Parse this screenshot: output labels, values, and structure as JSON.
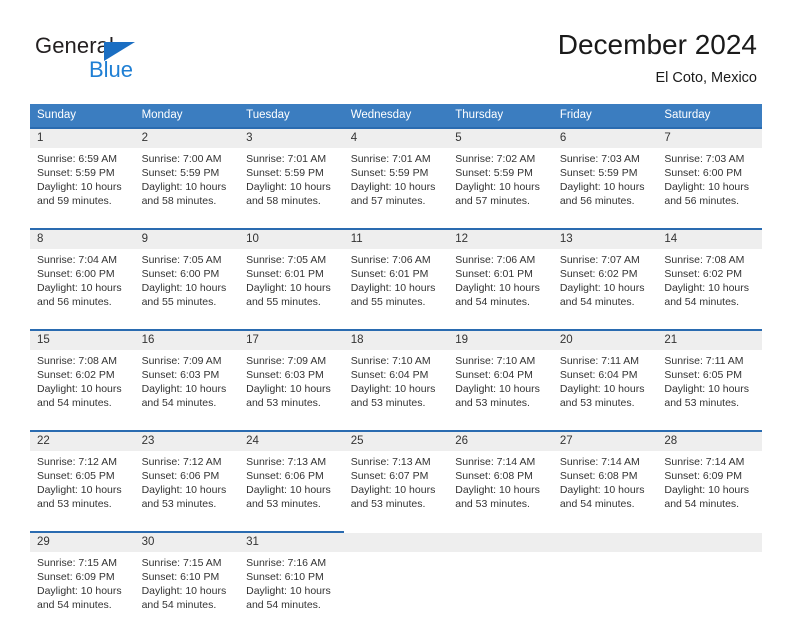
{
  "logo": {
    "word_one": "General",
    "word_two": "Blue",
    "triangle_icon": "blue-triangle-icon",
    "blue": "#1f7fd4",
    "dark": "#231f20"
  },
  "header": {
    "title": "December 2024",
    "subtitle": "El Coto, Mexico"
  },
  "colors": {
    "header_row": "#3b7dc0",
    "week_rule": "#2a6bb0",
    "daynum_band": "#eeeeee",
    "text": "#333333"
  },
  "weekday_headers": [
    "Sunday",
    "Monday",
    "Tuesday",
    "Wednesday",
    "Thursday",
    "Friday",
    "Saturday"
  ],
  "weeks": [
    {
      "days": [
        {
          "num": "1",
          "sunrise": "Sunrise: 6:59 AM",
          "sunset": "Sunset: 5:59 PM",
          "daylight1": "Daylight: 10 hours",
          "daylight2": "and 59 minutes."
        },
        {
          "num": "2",
          "sunrise": "Sunrise: 7:00 AM",
          "sunset": "Sunset: 5:59 PM",
          "daylight1": "Daylight: 10 hours",
          "daylight2": "and 58 minutes."
        },
        {
          "num": "3",
          "sunrise": "Sunrise: 7:01 AM",
          "sunset": "Sunset: 5:59 PM",
          "daylight1": "Daylight: 10 hours",
          "daylight2": "and 58 minutes."
        },
        {
          "num": "4",
          "sunrise": "Sunrise: 7:01 AM",
          "sunset": "Sunset: 5:59 PM",
          "daylight1": "Daylight: 10 hours",
          "daylight2": "and 57 minutes."
        },
        {
          "num": "5",
          "sunrise": "Sunrise: 7:02 AM",
          "sunset": "Sunset: 5:59 PM",
          "daylight1": "Daylight: 10 hours",
          "daylight2": "and 57 minutes."
        },
        {
          "num": "6",
          "sunrise": "Sunrise: 7:03 AM",
          "sunset": "Sunset: 5:59 PM",
          "daylight1": "Daylight: 10 hours",
          "daylight2": "and 56 minutes."
        },
        {
          "num": "7",
          "sunrise": "Sunrise: 7:03 AM",
          "sunset": "Sunset: 6:00 PM",
          "daylight1": "Daylight: 10 hours",
          "daylight2": "and 56 minutes."
        }
      ]
    },
    {
      "days": [
        {
          "num": "8",
          "sunrise": "Sunrise: 7:04 AM",
          "sunset": "Sunset: 6:00 PM",
          "daylight1": "Daylight: 10 hours",
          "daylight2": "and 56 minutes."
        },
        {
          "num": "9",
          "sunrise": "Sunrise: 7:05 AM",
          "sunset": "Sunset: 6:00 PM",
          "daylight1": "Daylight: 10 hours",
          "daylight2": "and 55 minutes."
        },
        {
          "num": "10",
          "sunrise": "Sunrise: 7:05 AM",
          "sunset": "Sunset: 6:01 PM",
          "daylight1": "Daylight: 10 hours",
          "daylight2": "and 55 minutes."
        },
        {
          "num": "11",
          "sunrise": "Sunrise: 7:06 AM",
          "sunset": "Sunset: 6:01 PM",
          "daylight1": "Daylight: 10 hours",
          "daylight2": "and 55 minutes."
        },
        {
          "num": "12",
          "sunrise": "Sunrise: 7:06 AM",
          "sunset": "Sunset: 6:01 PM",
          "daylight1": "Daylight: 10 hours",
          "daylight2": "and 54 minutes."
        },
        {
          "num": "13",
          "sunrise": "Sunrise: 7:07 AM",
          "sunset": "Sunset: 6:02 PM",
          "daylight1": "Daylight: 10 hours",
          "daylight2": "and 54 minutes."
        },
        {
          "num": "14",
          "sunrise": "Sunrise: 7:08 AM",
          "sunset": "Sunset: 6:02 PM",
          "daylight1": "Daylight: 10 hours",
          "daylight2": "and 54 minutes."
        }
      ]
    },
    {
      "days": [
        {
          "num": "15",
          "sunrise": "Sunrise: 7:08 AM",
          "sunset": "Sunset: 6:02 PM",
          "daylight1": "Daylight: 10 hours",
          "daylight2": "and 54 minutes."
        },
        {
          "num": "16",
          "sunrise": "Sunrise: 7:09 AM",
          "sunset": "Sunset: 6:03 PM",
          "daylight1": "Daylight: 10 hours",
          "daylight2": "and 54 minutes."
        },
        {
          "num": "17",
          "sunrise": "Sunrise: 7:09 AM",
          "sunset": "Sunset: 6:03 PM",
          "daylight1": "Daylight: 10 hours",
          "daylight2": "and 53 minutes."
        },
        {
          "num": "18",
          "sunrise": "Sunrise: 7:10 AM",
          "sunset": "Sunset: 6:04 PM",
          "daylight1": "Daylight: 10 hours",
          "daylight2": "and 53 minutes."
        },
        {
          "num": "19",
          "sunrise": "Sunrise: 7:10 AM",
          "sunset": "Sunset: 6:04 PM",
          "daylight1": "Daylight: 10 hours",
          "daylight2": "and 53 minutes."
        },
        {
          "num": "20",
          "sunrise": "Sunrise: 7:11 AM",
          "sunset": "Sunset: 6:04 PM",
          "daylight1": "Daylight: 10 hours",
          "daylight2": "and 53 minutes."
        },
        {
          "num": "21",
          "sunrise": "Sunrise: 7:11 AM",
          "sunset": "Sunset: 6:05 PM",
          "daylight1": "Daylight: 10 hours",
          "daylight2": "and 53 minutes."
        }
      ]
    },
    {
      "days": [
        {
          "num": "22",
          "sunrise": "Sunrise: 7:12 AM",
          "sunset": "Sunset: 6:05 PM",
          "daylight1": "Daylight: 10 hours",
          "daylight2": "and 53 minutes."
        },
        {
          "num": "23",
          "sunrise": "Sunrise: 7:12 AM",
          "sunset": "Sunset: 6:06 PM",
          "daylight1": "Daylight: 10 hours",
          "daylight2": "and 53 minutes."
        },
        {
          "num": "24",
          "sunrise": "Sunrise: 7:13 AM",
          "sunset": "Sunset: 6:06 PM",
          "daylight1": "Daylight: 10 hours",
          "daylight2": "and 53 minutes."
        },
        {
          "num": "25",
          "sunrise": "Sunrise: 7:13 AM",
          "sunset": "Sunset: 6:07 PM",
          "daylight1": "Daylight: 10 hours",
          "daylight2": "and 53 minutes."
        },
        {
          "num": "26",
          "sunrise": "Sunrise: 7:14 AM",
          "sunset": "Sunset: 6:08 PM",
          "daylight1": "Daylight: 10 hours",
          "daylight2": "and 53 minutes."
        },
        {
          "num": "27",
          "sunrise": "Sunrise: 7:14 AM",
          "sunset": "Sunset: 6:08 PM",
          "daylight1": "Daylight: 10 hours",
          "daylight2": "and 54 minutes."
        },
        {
          "num": "28",
          "sunrise": "Sunrise: 7:14 AM",
          "sunset": "Sunset: 6:09 PM",
          "daylight1": "Daylight: 10 hours",
          "daylight2": "and 54 minutes."
        }
      ]
    },
    {
      "days": [
        {
          "num": "29",
          "sunrise": "Sunrise: 7:15 AM",
          "sunset": "Sunset: 6:09 PM",
          "daylight1": "Daylight: 10 hours",
          "daylight2": "and 54 minutes."
        },
        {
          "num": "30",
          "sunrise": "Sunrise: 7:15 AM",
          "sunset": "Sunset: 6:10 PM",
          "daylight1": "Daylight: 10 hours",
          "daylight2": "and 54 minutes."
        },
        {
          "num": "31",
          "sunrise": "Sunrise: 7:16 AM",
          "sunset": "Sunset: 6:10 PM",
          "daylight1": "Daylight: 10 hours",
          "daylight2": "and 54 minutes."
        },
        {
          "num": "",
          "sunrise": "",
          "sunset": "",
          "daylight1": "",
          "daylight2": ""
        },
        {
          "num": "",
          "sunrise": "",
          "sunset": "",
          "daylight1": "",
          "daylight2": ""
        },
        {
          "num": "",
          "sunrise": "",
          "sunset": "",
          "daylight1": "",
          "daylight2": ""
        },
        {
          "num": "",
          "sunrise": "",
          "sunset": "",
          "daylight1": "",
          "daylight2": ""
        }
      ]
    }
  ]
}
